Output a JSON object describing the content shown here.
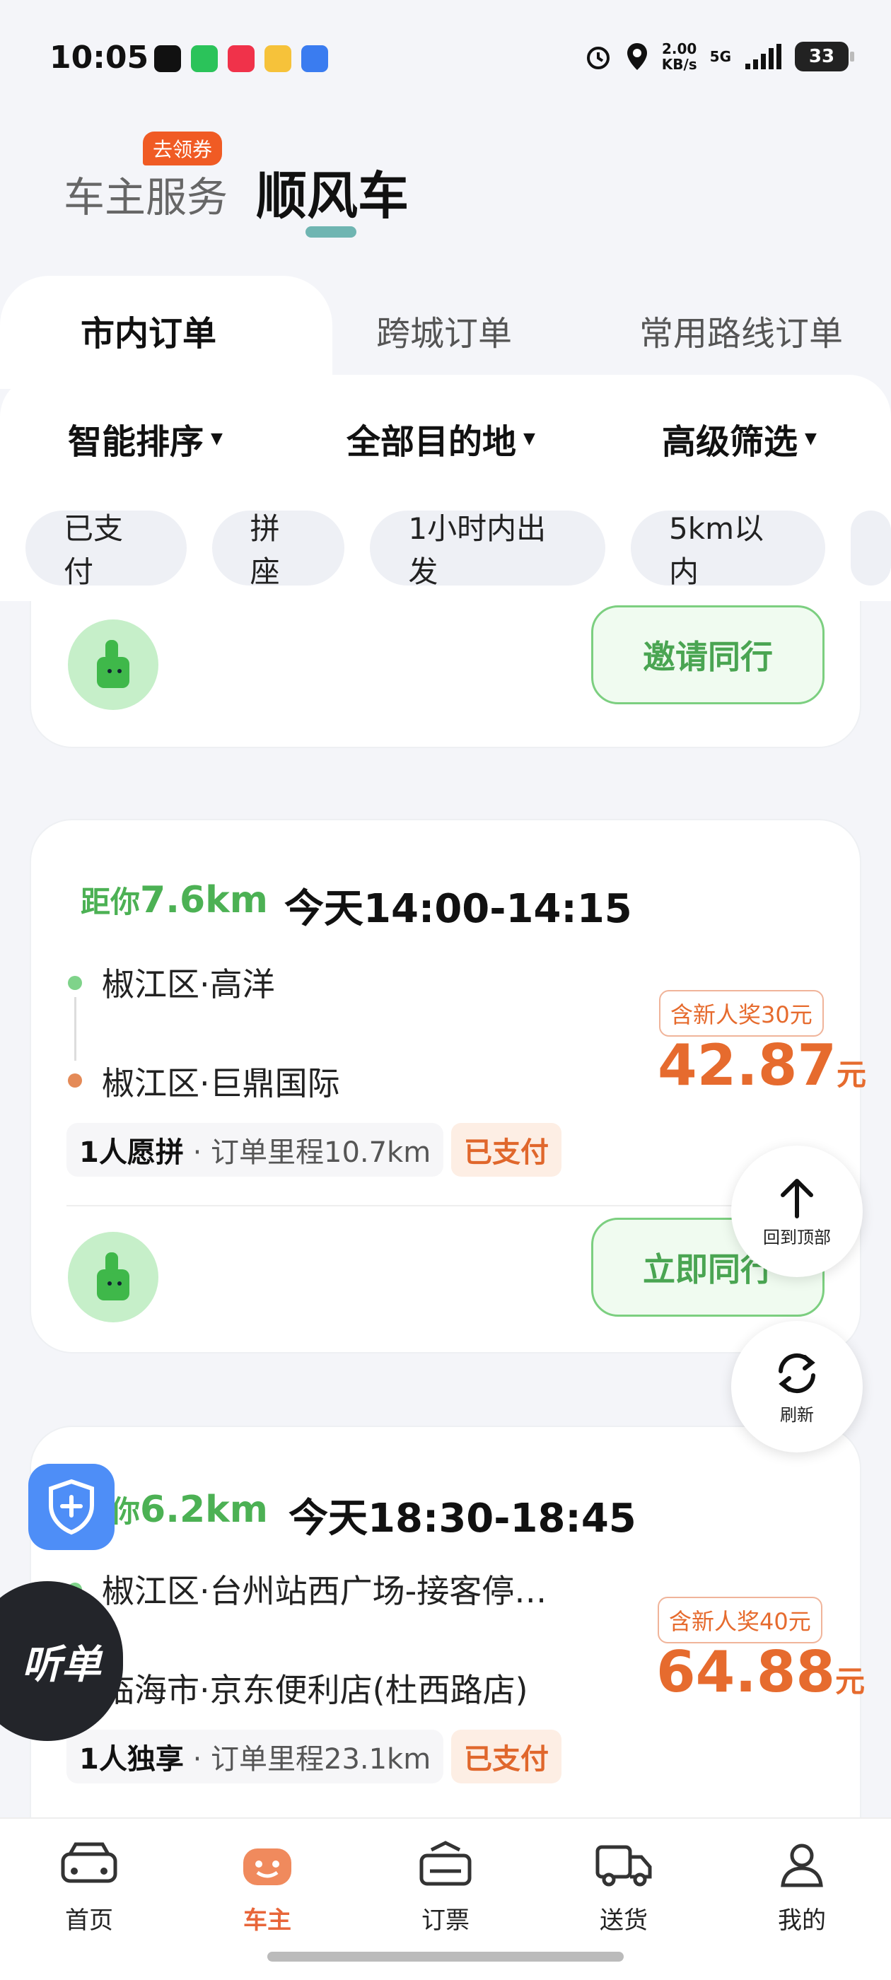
{
  "status_bar": {
    "time": "10:05",
    "speed_value": "2.00",
    "speed_unit": "KB/s",
    "network": "5G",
    "battery": "33"
  },
  "header": {
    "tab_service": "车主服务",
    "coupon_badge": "去领券",
    "tab_ride": "顺风车"
  },
  "order_tabs": [
    "市内订单",
    "跨城订单",
    "常用路线订单"
  ],
  "filters": [
    "智能排序",
    "全部目的地",
    "高级筛选"
  ],
  "chips": [
    "已支付",
    "拼座",
    "1小时内出发",
    "5km以内"
  ],
  "card0": {
    "button": "邀请同行"
  },
  "card1": {
    "dist_label": "距你",
    "dist_value": "7.6km",
    "time": "今天14:00-14:15",
    "from": "椒江区·高洋",
    "to": "椒江区·巨鼎国际",
    "promo": "含新人奖30元",
    "price": "42.87",
    "unit": "元",
    "riders": "1人愿拼",
    "mileage": "· 订单里程10.7km",
    "paid": "已支付",
    "button": "立即同行"
  },
  "card2": {
    "dist_label": "距你",
    "dist_value": "6.2km",
    "time": "今天18:30-18:45",
    "from": "椒江区·台州站西广场-接客停…",
    "to": "临海市·京东便利店(杜西路店)",
    "promo": "含新人奖40元",
    "price": "64.88",
    "unit": "元",
    "riders": "1人独享",
    "mileage": "· 订单里程23.1km",
    "paid": "已支付"
  },
  "floating": {
    "back_top": "回到顶部",
    "refresh": "刷新",
    "listen": "听单"
  },
  "bottom_nav": [
    "首页",
    "车主",
    "订票",
    "送货",
    "我的"
  ],
  "colors": {
    "green": "#4cb154",
    "orange": "#e66b2e",
    "accent_nav": "#e8663a"
  }
}
